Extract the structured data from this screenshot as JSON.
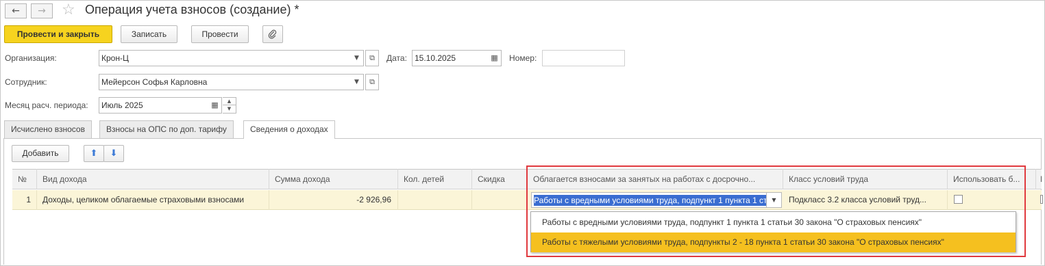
{
  "window": {
    "title": "Операция учета взносов (создание) *",
    "back_icon": "←",
    "forward_icon": "→",
    "star_icon": "☆"
  },
  "toolbar": {
    "post_and_close": "Провести и закрыть",
    "save": "Записать",
    "post": "Провести",
    "attach_icon": "paperclip-icon"
  },
  "form": {
    "organization_label": "Организация:",
    "organization_value": "Крон-Ц",
    "date_label": "Дата:",
    "date_value": "15.10.2025",
    "number_label": "Номер:",
    "number_value": "",
    "employee_label": "Сотрудник:",
    "employee_value": "Мейерсон Софья Карловна",
    "month_label": "Месяц расч. периода:",
    "month_value": "Июль 2025"
  },
  "tabs": [
    {
      "label": "Исчислено взносов",
      "active": false
    },
    {
      "label": "Взносы на ОПС по доп. тарифу",
      "active": false
    },
    {
      "label": "Сведения о доходах",
      "active": true
    }
  ],
  "table_toolbar": {
    "add": "Добавить"
  },
  "table": {
    "columns": [
      "№",
      "Вид дохода",
      "Сумма дохода",
      "Кол. детей",
      "Скидка",
      "Облагается взносами за занятых на работах с досрочно...",
      "Класс условий труда",
      "Использовать б...",
      "В"
    ],
    "rows": [
      {
        "num": "1",
        "income_type": "Доходы, целиком облагаемые страховыми взносами",
        "amount": "-2 926,96",
        "children": "",
        "discount": "",
        "taxed_edit": "Работы с вредными условиями труда, подпункт 1 пункта 1 статьи 30 закона \"О страховых пенсиях\"",
        "work_class": "Подкласс 3.2 класса условий труд...",
        "use_checked": false
      }
    ]
  },
  "dropdown": {
    "options": [
      "Работы с вредными условиями труда, подпункт 1 пункта 1 статьи 30 закона \"О страховых пенсиях\"",
      "Работы с тяжелыми условиями труда, подпункты 2 - 18 пункта 1 статьи 30 закона \"О страховых пенсиях\""
    ],
    "selected_index": 1
  },
  "colors": {
    "primary_button": "#f6d31f",
    "selected_option": "#f5c01f",
    "row_highlight": "#fbf5d8",
    "annotation_border": "#e0393e",
    "edit_selection": "#3a6dd1"
  }
}
